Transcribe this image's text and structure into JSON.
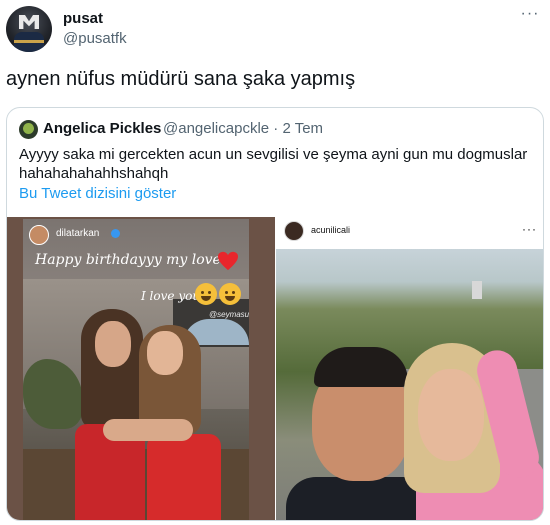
{
  "tweet": {
    "author_name": "pusat",
    "author_handle": "@pusatfk",
    "text": "aynen nüfus müdürü sana şaka yapmış",
    "more_label": "···"
  },
  "quoted_tweet": {
    "author_name": "Angelica Pickles",
    "author_handle": "@angelicapckle · 2 Tem",
    "text": "Ayyyy saka mi gercekten acun un sevgilisi ve şeyma ayni gun mu dogmuslar hahahahahahhshahqh",
    "thread_link": "Bu Tweet dizisini göster"
  },
  "left_image": {
    "story_username": "dilatarkan",
    "caption_1": "Happy birthdayyy my love",
    "caption_2": "I love you",
    "tag": "@seymasubasi"
  },
  "right_image": {
    "post_username": "acunilicali",
    "more_label": "···"
  },
  "colors": {
    "link": "#1d9bf0",
    "secondary_text": "#536471",
    "border": "#cfd9de"
  }
}
